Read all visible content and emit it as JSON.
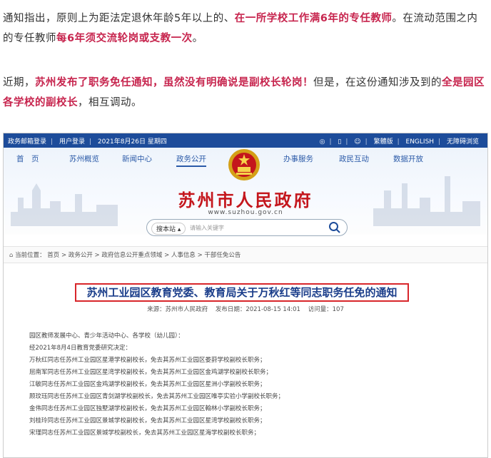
{
  "article": {
    "para1": [
      {
        "t": "通知指出，原则上为距法定退休年龄5年以上的、",
        "hl": false
      },
      {
        "t": "在一所学校工作满6年的专任教师",
        "hl": true
      },
      {
        "t": "。在流动范围之内的专任教师",
        "hl": false
      },
      {
        "t": "每6年须交流轮岗或支教一次",
        "hl": true
      },
      {
        "t": "。",
        "hl": false
      }
    ],
    "para2": [
      {
        "t": "近期，",
        "hl": false
      },
      {
        "t": "苏州发布了职务免任通知，虽然没有明确说是副校长轮岗！",
        "hl": true
      },
      {
        "t": "但是，在这份通知涉及到的",
        "hl": false
      },
      {
        "t": "全是园区各学校的副校长",
        "hl": true
      },
      {
        "t": "，相互调动。",
        "hl": false
      }
    ]
  },
  "screenshot": {
    "topbar_left": [
      "政务邮箱登录",
      "用户登录",
      "2021年8月26日 星期四"
    ],
    "topbar_right": [
      "繁體版",
      "ENGLISH",
      "无障碍浏览"
    ],
    "nav": [
      "首　页",
      "苏州概览",
      "新闻中心",
      "政务公开",
      "办事服务",
      "政民互动",
      "数据开放"
    ],
    "site_title": "苏州市人民政府",
    "site_url": "www.suzhou.gov.cn",
    "search_select": "搜本站",
    "search_placeholder": "请输入关键字",
    "breadcrumb": "当前位置： 首页 > 政务公开 > 政府信息公开重点领域 > 人事信息 > 干部任免公告",
    "notice_title": "苏州工业园区教育党委、教育局关于万秋红等同志职务任免的通知",
    "meta_source": "来源：苏州市人民政府",
    "meta_date": "发布日期：2021-08-15 14:01",
    "meta_views": "访问量：107",
    "body_lines": [
      "园区教师发展中心、青少年活动中心、各学校（幼儿园）：",
      "经2021年8月4日教育党委研究决定：",
      "万秋红同志任苏州工业园区星港学校副校长，免去其苏州工业园区娄葑学校副校长职务；",
      "屈南军同志任苏州工业园区星湾学校副校长，免去其苏州工业园区金鸡湖学校副校长职务；",
      "江敏同志任苏州工业园区金鸡湖学校副校长，免去其苏州工业园区星洲小学副校长职务；",
      "顾玟珏同志任苏州工业园区青剑湖学校副校长，免去其苏州工业园区唯亭实验小学副校长职务；",
      "金伟同志任苏州工业园区独墅湖学校副校长，免去其苏州工业园区翰林小学副校长职务；",
      "刘桂玲同志任苏州工业园区景城学校副校长，免去其苏州工业园区星湾学校副校长职务；",
      "宋瑾同志任苏州工业园区景城学校副校长，免去其苏州工业园区星海学校副校长职务；"
    ],
    "colors": {
      "topbar": "#1d4c9a",
      "title_red": "#c4161c",
      "notice_border": "#d8262b",
      "notice_text": "#1a3d8a",
      "highlight": "#c7254e"
    }
  }
}
